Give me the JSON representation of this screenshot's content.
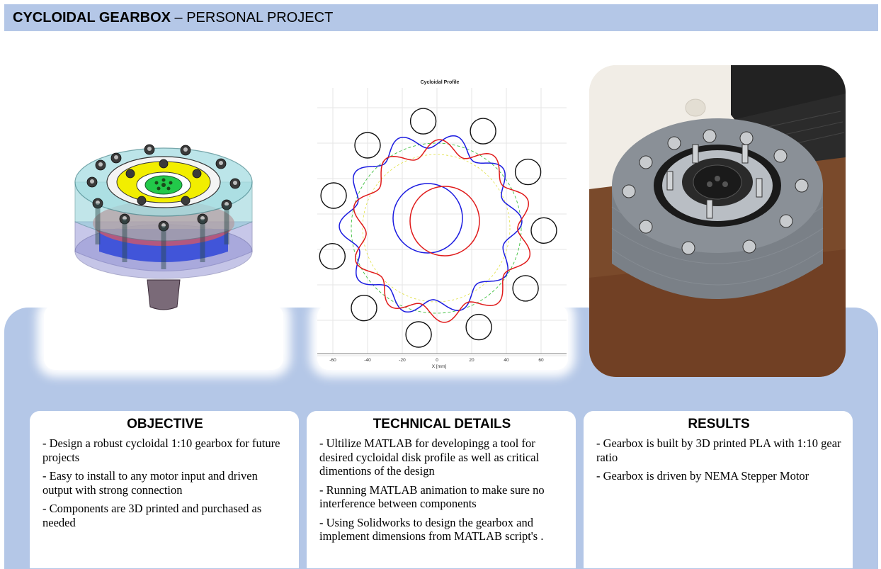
{
  "header": {
    "title_bold": "CYCLOIDAL GEARBOX",
    "title_rest": " – PERSONAL PROJECT"
  },
  "colors": {
    "header_band": "#b4c7e7",
    "cad_housing": "#8fd0d8",
    "cad_yellow": "#f2ee00",
    "cad_green": "#22c94a",
    "profile_red": "#e01b1b",
    "profile_blue": "#1b1be0",
    "profile_pitch": "#40c040",
    "photo_gray": "#7a8087",
    "photo_wood": "#7a4a2b"
  },
  "profile_plot": {
    "title": "Cycloidal Profile",
    "xlabel": "X [mm]",
    "xticks": [
      "-60",
      "-40",
      "-20",
      "0",
      "20",
      "40",
      "60"
    ]
  },
  "cards": [
    {
      "heading": "OBJECTIVE",
      "items": [
        "- Design a robust cycloidal 1:10 gearbox for future projects",
        "- Easy to install to any motor input and driven output with strong connection",
        "- Components are 3D printed and purchased as needed"
      ]
    },
    {
      "heading": "TECHNICAL DETAILS",
      "items": [
        "- Ultilize MATLAB for developingg a tool for desired cycloidal disk profile as well as critical dimentions of  the design",
        "- Running MATLAB animation to make sure no interference between components",
        "- Using Solidworks to design the gearbox and implement dimensions from MATLAB script's ."
      ]
    },
    {
      "heading": "RESULTS",
      "items": [
        "- Gearbox is built by 3D printed PLA with 1:10 gear ratio",
        "- Gearbox is driven by NEMA Stepper Motor"
      ]
    }
  ]
}
